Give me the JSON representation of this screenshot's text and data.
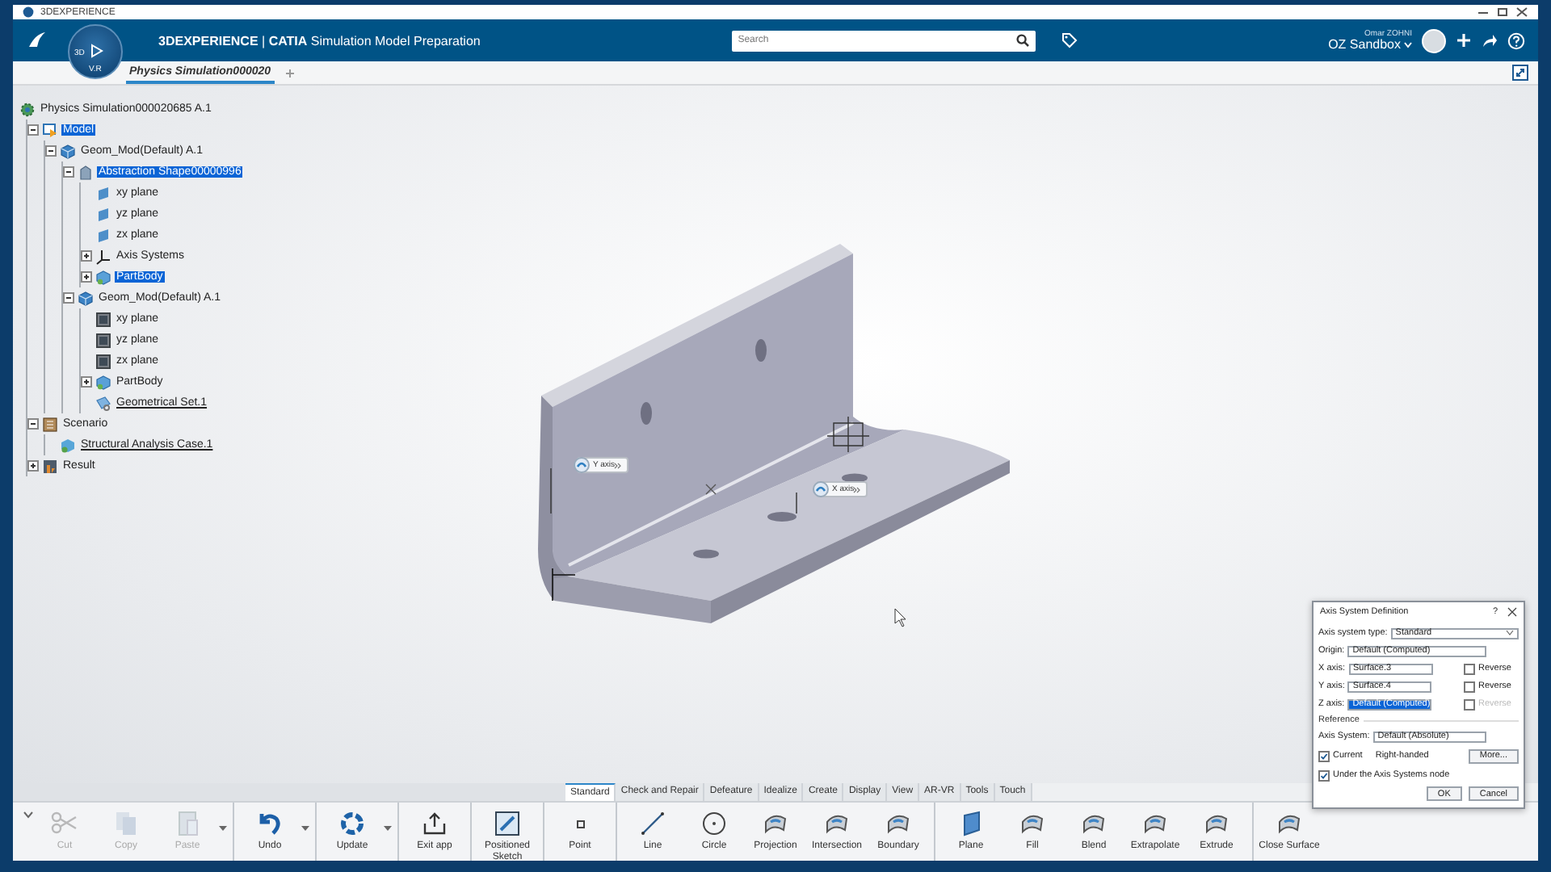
{
  "window": {
    "title": "3DEXPERIENCE"
  },
  "header": {
    "brand": "3DEXPERIENCE",
    "separator": "|",
    "app": "CATIA",
    "subtitle": "Simulation Model Preparation",
    "compass": {
      "left": "3D",
      "bottom": "V.R"
    },
    "search": {
      "placeholder": "Search"
    },
    "user": "Omar ZOHNI",
    "space": "OZ Sandbox"
  },
  "tabs": [
    {
      "label": "Physics Simulation000020",
      "selected": true
    }
  ],
  "tree": [
    {
      "label": "Physics Simulation000020685 A.1",
      "kind": "product",
      "selected": false,
      "underlined": false,
      "children": [
        {
          "label": "Model",
          "kind": "model",
          "expanded": true,
          "selected": true,
          "underlined": false,
          "children": [
            {
              "label": "Geom_Mod(Default) A.1",
              "kind": "geom",
              "expanded": true,
              "selected": false,
              "underlined": false,
              "children": [
                {
                  "label": "Abstraction Shape00000996",
                  "kind": "shape",
                  "expanded": true,
                  "selected": true,
                  "underlined": false,
                  "children": [
                    {
                      "label": "xy plane",
                      "kind": "plane",
                      "selected": false,
                      "underlined": false
                    },
                    {
                      "label": "yz plane",
                      "kind": "plane",
                      "selected": false,
                      "underlined": false
                    },
                    {
                      "label": "zx plane",
                      "kind": "plane",
                      "selected": false,
                      "underlined": false
                    },
                    {
                      "label": "Axis Systems",
                      "kind": "axis",
                      "expanded": false,
                      "selected": false,
                      "underlined": false
                    },
                    {
                      "label": "PartBody",
                      "kind": "body",
                      "expanded": false,
                      "selected": true,
                      "underlined": false
                    }
                  ]
                },
                {
                  "label": "Geom_Mod(Default) A.1",
                  "kind": "geom",
                  "expanded": true,
                  "selected": false,
                  "underlined": false,
                  "children": [
                    {
                      "label": "xy plane",
                      "kind": "plane-dark",
                      "selected": false,
                      "underlined": false
                    },
                    {
                      "label": "yz plane",
                      "kind": "plane-dark",
                      "selected": false,
                      "underlined": false
                    },
                    {
                      "label": "zx plane",
                      "kind": "plane-dark",
                      "selected": false,
                      "underlined": false
                    },
                    {
                      "label": "PartBody",
                      "kind": "body",
                      "expanded": false,
                      "selected": false,
                      "underlined": false
                    },
                    {
                      "label": "Geometrical Set.1",
                      "kind": "geomset",
                      "selected": false,
                      "underlined": true
                    }
                  ]
                }
              ]
            }
          ]
        },
        {
          "label": "Scenario",
          "kind": "scenario",
          "expanded": true,
          "selected": false,
          "underlined": false,
          "children": [
            {
              "label": "Structural Analysis Case.1",
              "kind": "case",
              "selected": false,
              "underlined": true
            }
          ]
        },
        {
          "label": "Result",
          "kind": "result",
          "expanded": false,
          "selected": false,
          "underlined": false
        }
      ]
    }
  ],
  "viewer": {
    "labels": [
      {
        "text": "Y axis"
      },
      {
        "text": "X axis"
      }
    ]
  },
  "dialog": {
    "title": "Axis System Definition",
    "help": "?",
    "fields": [
      {
        "label": "Axis system type:",
        "value": "Standard",
        "kind": "dropdown",
        "highlighted": false
      },
      {
        "label": "Origin:",
        "value": "Default (Computed)",
        "kind": "text",
        "highlighted": false
      },
      {
        "label": "X axis:",
        "value": "Surface.3",
        "kind": "axis",
        "highlighted": false,
        "reverse": {
          "label": "Reverse",
          "checked": false,
          "disabled": false
        }
      },
      {
        "label": "Y axis:",
        "value": "Surface.4",
        "kind": "axis",
        "highlighted": false,
        "reverse": {
          "label": "Reverse",
          "checked": false,
          "disabled": false
        }
      },
      {
        "label": "Z axis:",
        "value": "Default (Computed)",
        "kind": "axis",
        "highlighted": true,
        "reverse": {
          "label": "Reverse",
          "checked": false,
          "disabled": true
        }
      }
    ],
    "section": "Reference",
    "reference": {
      "label": "Axis System:",
      "value": "Default (Absolute)"
    },
    "current": {
      "label": "Current",
      "checked": true
    },
    "handedness": "Right-handed",
    "more": "More...",
    "under_node": {
      "label": "Under the Axis Systems node",
      "checked": true
    },
    "buttons": [
      "OK",
      "Cancel"
    ]
  },
  "ribbon": {
    "tabs": [
      {
        "label": "Standard",
        "selected": true
      },
      {
        "label": "Check and Repair",
        "selected": false
      },
      {
        "label": "Defeature",
        "selected": false
      },
      {
        "label": "Idealize",
        "selected": false
      },
      {
        "label": "Create",
        "selected": false
      },
      {
        "label": "Display",
        "selected": false
      },
      {
        "label": "View",
        "selected": false
      },
      {
        "label": "AR-VR",
        "selected": false
      },
      {
        "label": "Tools",
        "selected": false
      },
      {
        "label": "Touch",
        "selected": false
      }
    ],
    "tools": [
      {
        "label": "Cut",
        "kind": "cut",
        "disabled": true,
        "dropdown": false,
        "separator_after": false
      },
      {
        "label": "Copy",
        "kind": "copy",
        "disabled": true,
        "dropdown": false,
        "separator_after": false
      },
      {
        "label": "Paste",
        "kind": "paste",
        "disabled": true,
        "dropdown": true,
        "separator_after": true
      },
      {
        "label": "Undo",
        "kind": "undo",
        "disabled": false,
        "dropdown": true,
        "separator_after": true
      },
      {
        "label": "Update",
        "kind": "update",
        "disabled": false,
        "dropdown": true,
        "separator_after": true
      },
      {
        "label": "Exit app",
        "kind": "exit",
        "disabled": false,
        "dropdown": false,
        "separator_after": true
      },
      {
        "label": "Positioned Sketch",
        "kind": "sketch",
        "disabled": false,
        "dropdown": false,
        "separator_after": true
      },
      {
        "label": "Point",
        "kind": "point",
        "disabled": false,
        "dropdown": false,
        "separator_after": true
      },
      {
        "label": "Line",
        "kind": "line",
        "disabled": false,
        "dropdown": false,
        "separator_after": false
      },
      {
        "label": "Circle",
        "kind": "circle",
        "disabled": false,
        "dropdown": false,
        "separator_after": false
      },
      {
        "label": "Projection",
        "kind": "surface",
        "disabled": false,
        "dropdown": false,
        "separator_after": false
      },
      {
        "label": "Intersection",
        "kind": "surface",
        "disabled": false,
        "dropdown": false,
        "separator_after": false
      },
      {
        "label": "Boundary",
        "kind": "surface",
        "disabled": false,
        "dropdown": false,
        "separator_after": true
      },
      {
        "label": "Plane",
        "kind": "plane",
        "disabled": false,
        "dropdown": false,
        "separator_after": false
      },
      {
        "label": "Fill",
        "kind": "surface",
        "disabled": false,
        "dropdown": false,
        "separator_after": false
      },
      {
        "label": "Blend",
        "kind": "surface",
        "disabled": false,
        "dropdown": false,
        "separator_after": false
      },
      {
        "label": "Extrapolate",
        "kind": "surface",
        "disabled": false,
        "dropdown": false,
        "separator_after": false
      },
      {
        "label": "Extrude",
        "kind": "surface",
        "disabled": false,
        "dropdown": false,
        "separator_after": true
      },
      {
        "label": "Close Surface",
        "kind": "surface",
        "disabled": false,
        "dropdown": false,
        "separator_after": false
      }
    ]
  }
}
